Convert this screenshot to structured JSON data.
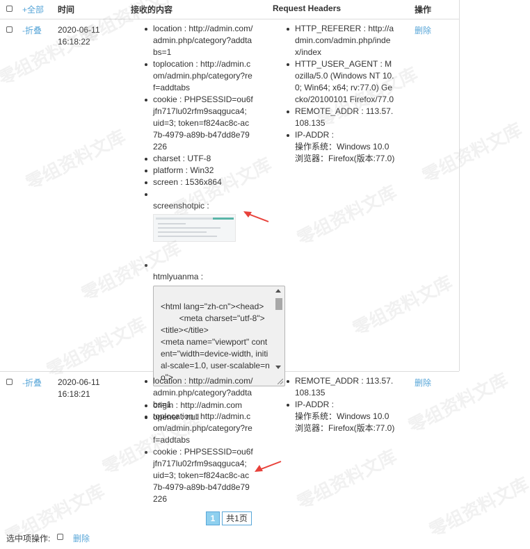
{
  "header": {
    "select_all": "+全部",
    "time": "时间",
    "content": "接收的内容",
    "request_headers": "Request Headers",
    "actions": "操作"
  },
  "rows": [
    {
      "toggle": "-折叠",
      "time": "2020-06-11\n16:18:22",
      "delete": "删除",
      "content": {
        "location": "location : http://admin.com/\nadmin.php/category?addta\nbs=1",
        "toplocation": "toplocation : http://admin.c\nom/admin.php/category?re\nf=addtabs",
        "cookie": "cookie : PHPSESSID=ou6f\njfn717lu02rfm9saqguca4;\nuid=3; token=f824ac8c-ac\n7b-4979-a89b-b47dd8e79\n226",
        "charset": "charset : UTF-8",
        "platform": "platform : Win32",
        "screen": "screen : 1536x864",
        "screenshotpic": "screenshotpic :",
        "htmlyuanma": "htmlyuanma :",
        "source": "<html lang=\"zh-cn\"><head>\n        <meta charset=\"utf-8\">\n<title></title>\n<meta name=\"viewport\" content=\"width=device-width, initial-scale=1.0, user-scalable=no\">\n<meta name=\"renderer\" content=\"webkit\">",
        "origin": "origin : http://admin.com",
        "opener": "opener : null"
      },
      "headers": {
        "referer": "HTTP_REFERER : http://a\ndmin.com/admin.php/inde\nx/index",
        "user_agent": "HTTP_USER_AGENT : M\nozilla/5.0 (Windows NT 10.\n0; Win64; x64; rv:77.0) Ge\ncko/20100101 Firefox/77.0",
        "remote_addr": "REMOTE_ADDR : 113.57.\n108.135",
        "ip_addr": "IP-ADDR :\n操作系统：Windows 10.0\n浏览器：Firefox(版本:77.0)"
      }
    },
    {
      "toggle": "-折叠",
      "time": "2020-06-11\n16:18:21",
      "delete": "删除",
      "content": {
        "location": "location : http://admin.com/\nadmin.php/category?addta\nbs=1",
        "toplocation": "toplocation : http://admin.c\nom/admin.php/category?re\nf=addtabs",
        "cookie": "cookie : PHPSESSID=ou6f\njfn717lu02rfm9saqguca4;\nuid=3; token=f824ac8c-ac\n7b-4979-a89b-b47dd8e79\n226"
      },
      "headers": {
        "remote_addr": "REMOTE_ADDR : 113.57.\n108.135",
        "ip_addr": "IP-ADDR :\n操作系统：Windows 10.0\n浏览器：Firefox(版本:77.0)"
      }
    }
  ],
  "pagination": {
    "current": "1",
    "total": "共1页"
  },
  "footer": {
    "selected_action_label": "选中项操作:",
    "delete": "删除"
  },
  "watermark": "零组资料文库",
  "colors": {
    "link": "#58a6d8",
    "arrow": "#e8413a",
    "border": "#dcdcdc"
  }
}
